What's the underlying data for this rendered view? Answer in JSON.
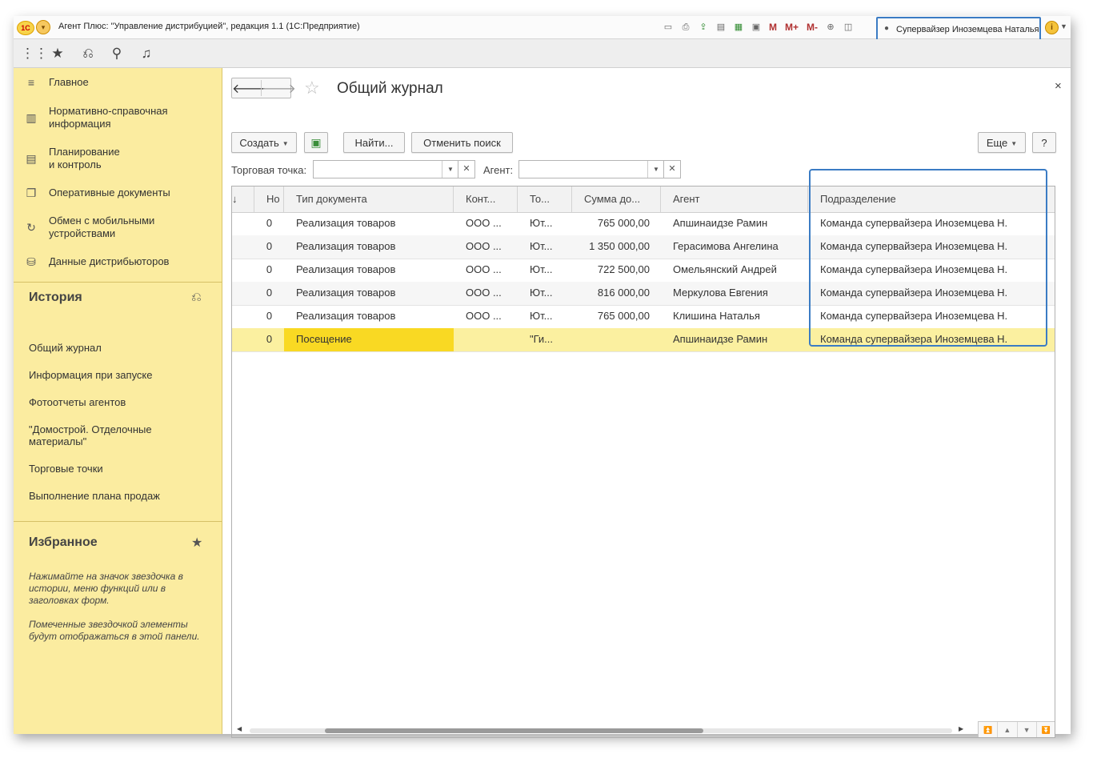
{
  "titlebar": {
    "logo_text": "1С",
    "app_title": "Агент Плюс: \"Управление дистрибуцией\", редакция 1.1   (1С:Предприятие)",
    "icons": [
      "save-icon",
      "print-icon",
      "export-icon",
      "print-preview-icon",
      "calculator-icon",
      "calendar-icon"
    ],
    "m_buttons": [
      "M",
      "M+",
      "M-"
    ],
    "user_label": "Супервайзер Иноземцева Наталья"
  },
  "sidebar": {
    "nav": [
      {
        "label": "Главное",
        "icon": "≡"
      },
      {
        "label": "Нормативно-справочная информация",
        "icon": "▥"
      },
      {
        "label": "Планирование и контроль",
        "icon": "▤"
      },
      {
        "label": "Оперативные документы",
        "icon": "❐"
      },
      {
        "label": "Обмен с мобильными устройствами",
        "icon": "↻"
      },
      {
        "label": "Данные дистрибьюторов",
        "icon": "⛁"
      }
    ],
    "nav_lines": {
      "n1a": "Нормативно-справочная",
      "n1b": "информация",
      "n2a": "Планирование",
      "n2b": "и контроль",
      "n4a": "Обмен с мобильными",
      "n4b": "устройствами"
    },
    "history_title": "История",
    "history": [
      "Общий журнал",
      "Информация при запуске",
      "Фотоотчеты агентов",
      "\"Домострой. Отделочные материалы\"",
      "Торговые точки",
      "Выполнение плана продаж"
    ],
    "favorites_title": "Избранное",
    "favorites_note1": "Нажимайте на значок звездочка в истории, меню функций или в заголовках форм.",
    "favorites_note2": "Помеченные звездочкой элементы будут отображаться в этой панели."
  },
  "main": {
    "title": "Общий журнал",
    "buttons": {
      "create": "Создать",
      "find": "Найти...",
      "cancel_search": "Отменить поиск",
      "more": "Еще",
      "help": "?"
    },
    "filters": {
      "outlet_label": "Торговая точка:",
      "agent_label": "Агент:",
      "outlet_value": "",
      "agent_value": ""
    },
    "table": {
      "columns": [
        "↓",
        "Но",
        "Тип документа",
        "Конт...",
        "То...",
        "Сумма до...",
        "Агент",
        "Подразделение"
      ],
      "rows": [
        [
          "",
          "0",
          "Реализация товаров",
          "ООО ...",
          "Ют...",
          "765 000,00",
          "Апшинаидзе Рамин",
          "Команда супервайзера  Иноземцева Н."
        ],
        [
          "",
          "0",
          "Реализация товаров",
          "ООО ...",
          "Ют...",
          "1 350 000,00",
          "Герасимова Ангелина",
          "Команда супервайзера  Иноземцева Н."
        ],
        [
          "",
          "0",
          "Реализация товаров",
          "ООО ...",
          "Ют...",
          "722 500,00",
          "Омельянский Андрей",
          "Команда супервайзера  Иноземцева Н."
        ],
        [
          "",
          "0",
          "Реализация товаров",
          "ООО ...",
          "Ют...",
          "816 000,00",
          "Меркулова Евгения",
          "Команда супервайзера  Иноземцева Н."
        ],
        [
          "",
          "0",
          "Реализация товаров",
          "ООО ...",
          "Ют...",
          "765 000,00",
          "Клишина Наталья",
          "Команда супервайзера  Иноземцева Н."
        ],
        [
          "",
          "0",
          "Посещение",
          "",
          "\"Ги...",
          "",
          "Апшинаидзе Рамин",
          "Команда супервайзера  Иноземцева Н."
        ]
      ],
      "selected_row": 5
    }
  },
  "colors": {
    "sidebar_bg": "#fbeca0",
    "highlight_blue": "#3b7cc4",
    "selected_row": "#fbf0a0",
    "current_cell": "#f9d923"
  }
}
